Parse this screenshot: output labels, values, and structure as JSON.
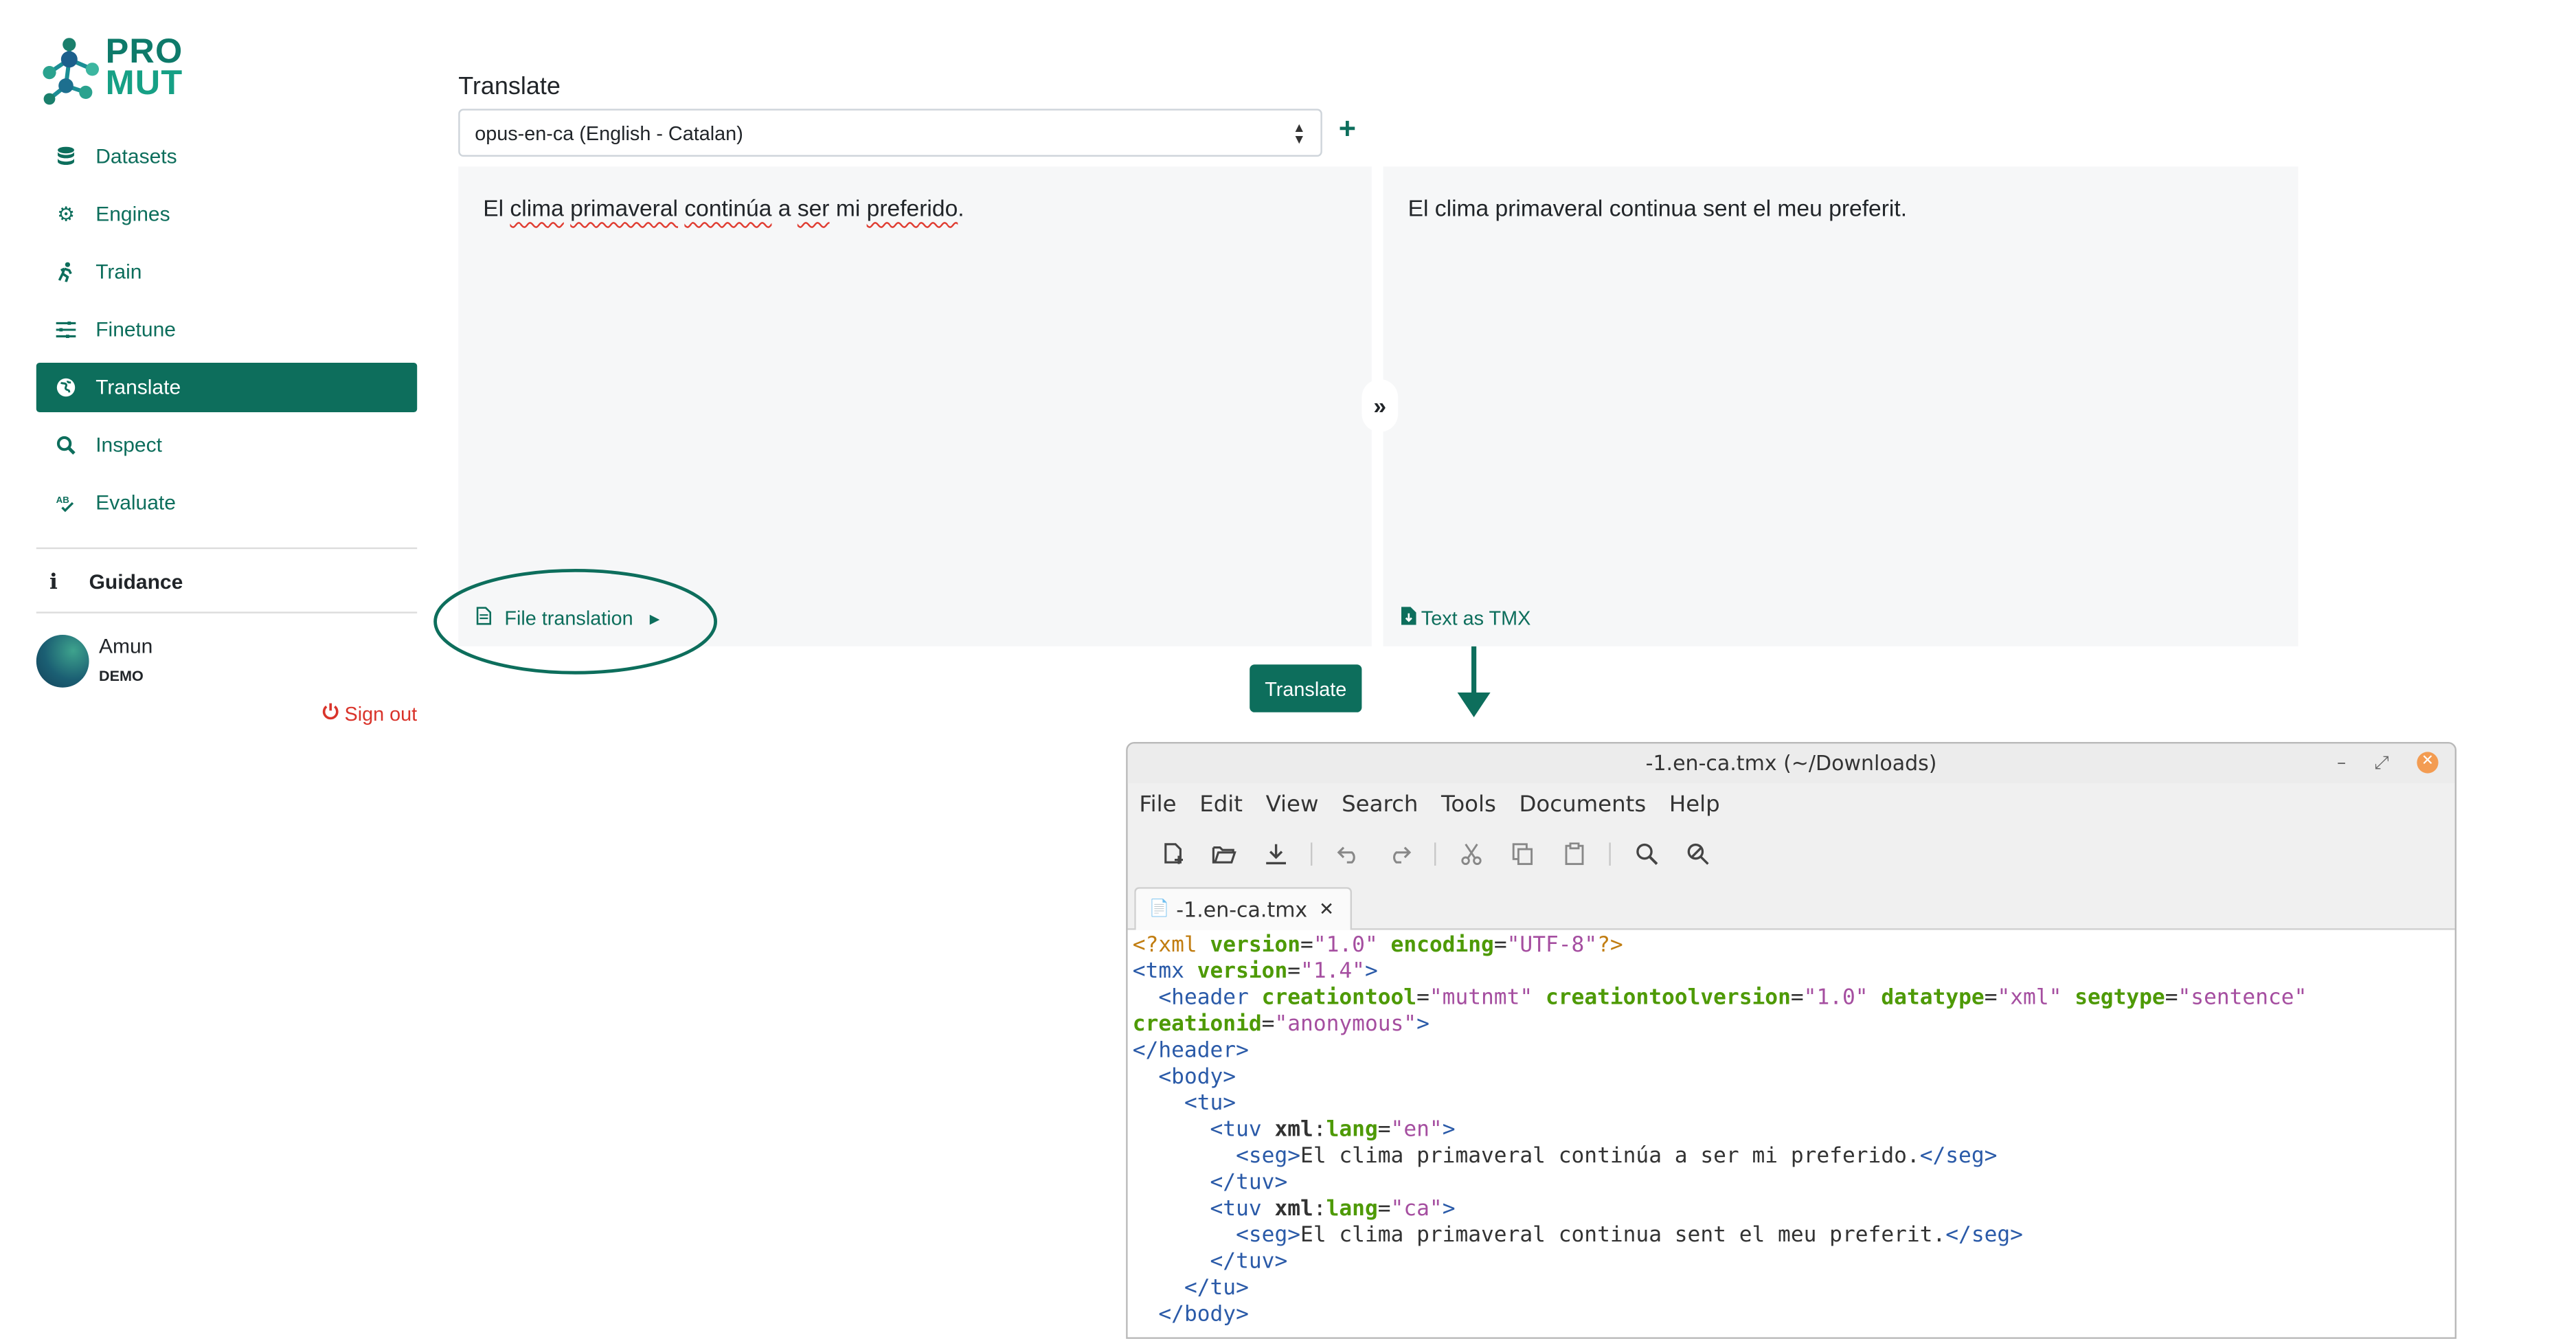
{
  "logo": {
    "line1": "PRO",
    "line2": "MUT"
  },
  "sidebar": {
    "items": [
      {
        "label": "Datasets",
        "icon": "database-icon"
      },
      {
        "label": "Engines",
        "icon": "gears-icon"
      },
      {
        "label": "Train",
        "icon": "running-icon"
      },
      {
        "label": "Finetune",
        "icon": "sliders-icon"
      },
      {
        "label": "Translate",
        "icon": "globe-icon",
        "active": true
      },
      {
        "label": "Inspect",
        "icon": "search-icon"
      },
      {
        "label": "Evaluate",
        "icon": "spell-check-icon"
      }
    ],
    "guidance": "Guidance",
    "user": {
      "name": "Amun",
      "role": "DEMO"
    },
    "signout": "Sign out"
  },
  "main": {
    "title": "Translate",
    "engine": "opus-en-ca (English - Catalan)",
    "source_text": "El clima primaveral continúa a ser mi preferido.",
    "target_text": "El clima primaveral continua sent el meu preferit.",
    "file_translation": "File translation",
    "tmx_link": "Text as TMX",
    "translate_button": "Translate"
  },
  "editor": {
    "title": "-1.en-ca.tmx (~/Downloads)",
    "menu": [
      "File",
      "Edit",
      "View",
      "Search",
      "Tools",
      "Documents",
      "Help"
    ],
    "tab": "-1.en-ca.tmx"
  },
  "colors": {
    "accent": "#0d6e5c",
    "signout": "#d9342b"
  }
}
